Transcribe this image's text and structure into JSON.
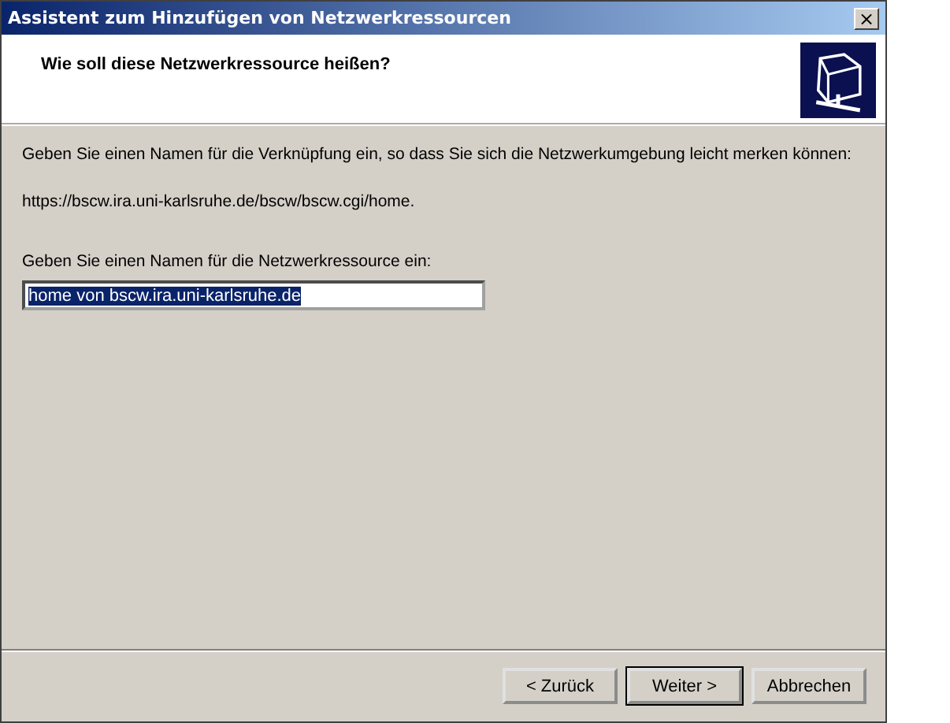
{
  "window": {
    "title": "Assistent zum Hinzufügen von Netzwerkressourcen",
    "close": "×"
  },
  "header": {
    "title": "Wie soll diese Netzwerkressource heißen?"
  },
  "body": {
    "intro": "Geben Sie einen Namen für die Verknüpfung ein, so dass Sie sich die Netzwerkumgebung leicht merken können:",
    "address": "https://bscw.ira.uni-karlsruhe.de/bscw/bscw.cgi/home.",
    "field_label": "Geben Sie einen Namen für die Netzwerkressource ein:",
    "field_value": "home von bscw.ira.uni-karlsruhe.de",
    "field_value_selected": true
  },
  "buttons": [
    {
      "label": "< Zurück",
      "default": false
    },
    {
      "label": "Weiter >",
      "default": true
    },
    {
      "label": "Abbrechen",
      "default": false
    }
  ]
}
